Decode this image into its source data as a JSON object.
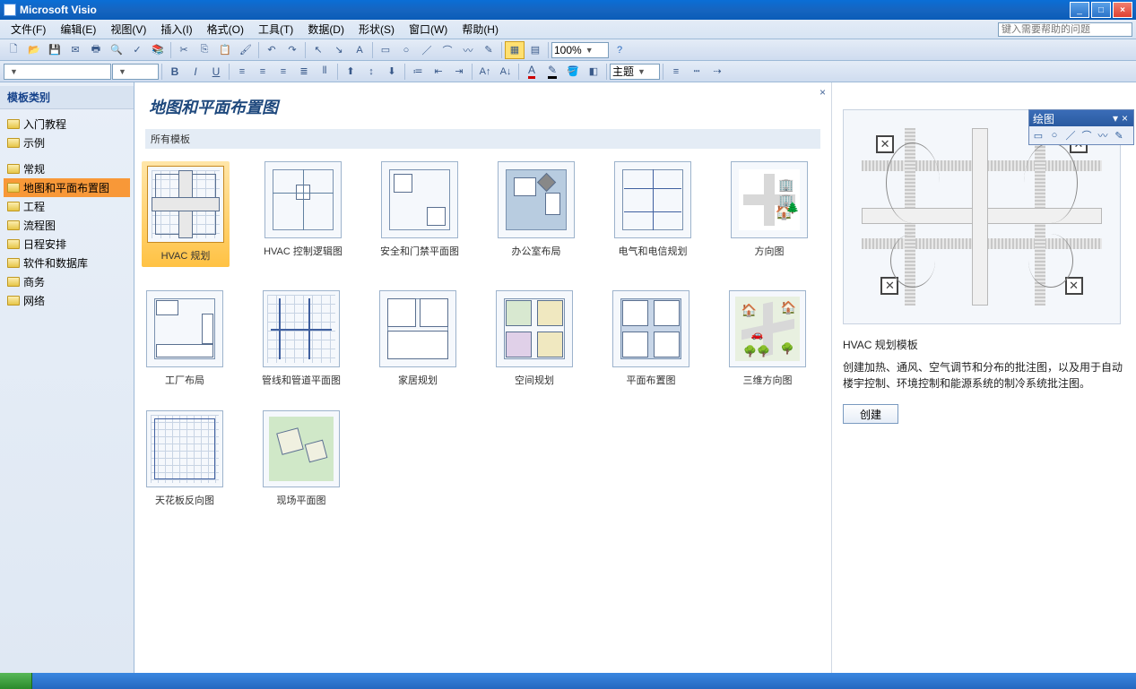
{
  "app": {
    "title": "Microsoft Visio"
  },
  "menu": {
    "items": [
      "文件(F)",
      "编辑(E)",
      "视图(V)",
      "插入(I)",
      "格式(O)",
      "工具(T)",
      "数据(D)",
      "形状(S)",
      "窗口(W)",
      "帮助(H)"
    ]
  },
  "helpbox": {
    "placeholder": "键入需要帮助的问题"
  },
  "toolbar2": {
    "zoom": "100%",
    "theme_label": "主题"
  },
  "sidebar": {
    "title": "模板类别",
    "group1": [
      {
        "label": "入门教程"
      },
      {
        "label": "示例"
      }
    ],
    "group2": [
      {
        "label": "常规"
      },
      {
        "label": "地图和平面布置图",
        "selected": true
      },
      {
        "label": "工程"
      },
      {
        "label": "流程图"
      },
      {
        "label": "日程安排"
      },
      {
        "label": "软件和数据库"
      },
      {
        "label": "商务"
      },
      {
        "label": "网络"
      }
    ]
  },
  "page": {
    "title": "地图和平面布置图",
    "section_label": "所有模板",
    "templates": [
      {
        "label": "HVAC 规划",
        "selected": true,
        "style": "hvac"
      },
      {
        "label": "HVAC 控制逻辑图",
        "style": "hvac-ctrl"
      },
      {
        "label": "安全和门禁平面图",
        "style": "security"
      },
      {
        "label": "办公室布局",
        "style": "office"
      },
      {
        "label": "电气和电信规划",
        "style": "electrical"
      },
      {
        "label": "方向图",
        "style": "direction"
      },
      {
        "label": "工厂布局",
        "style": "factory"
      },
      {
        "label": "管线和管道平面图",
        "style": "pipe"
      },
      {
        "label": "家居规划",
        "style": "home"
      },
      {
        "label": "空间规划",
        "style": "space"
      },
      {
        "label": "平面布置图",
        "style": "floor"
      },
      {
        "label": "三维方向图",
        "style": "3d-dir"
      },
      {
        "label": "天花板反向图",
        "style": "ceiling"
      },
      {
        "label": "现场平面图",
        "style": "site"
      }
    ]
  },
  "preview": {
    "title": "HVAC 规划模板",
    "desc": "创建加热、通风、空气调节和分布的批注图，以及用于自动楼宇控制、环境控制和能源系统的制冷系统批注图。",
    "create": "创建"
  },
  "float": {
    "title": "绘图"
  }
}
